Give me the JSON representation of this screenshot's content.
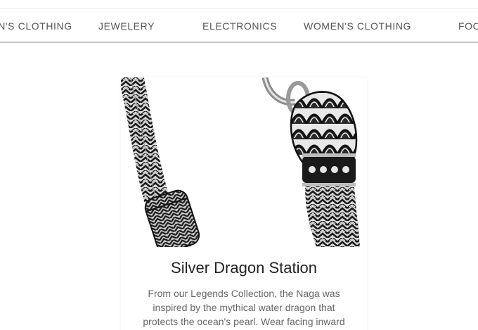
{
  "nav": {
    "items": [
      {
        "label": "MEN'S CLOTHING"
      },
      {
        "label": "JEWELERY"
      },
      {
        "label": "ELECTRONICS"
      },
      {
        "label": "WOMEN'S CLOTHING"
      },
      {
        "label": "FOOD"
      }
    ]
  },
  "product": {
    "image_icon": "dragon-chain-bracelet-image",
    "title": "Silver Dragon Station",
    "description": "From our Legends Collection, the Naga was inspired by the mythical water dragon that protects the ocean's pearl. Wear facing inward to"
  }
}
